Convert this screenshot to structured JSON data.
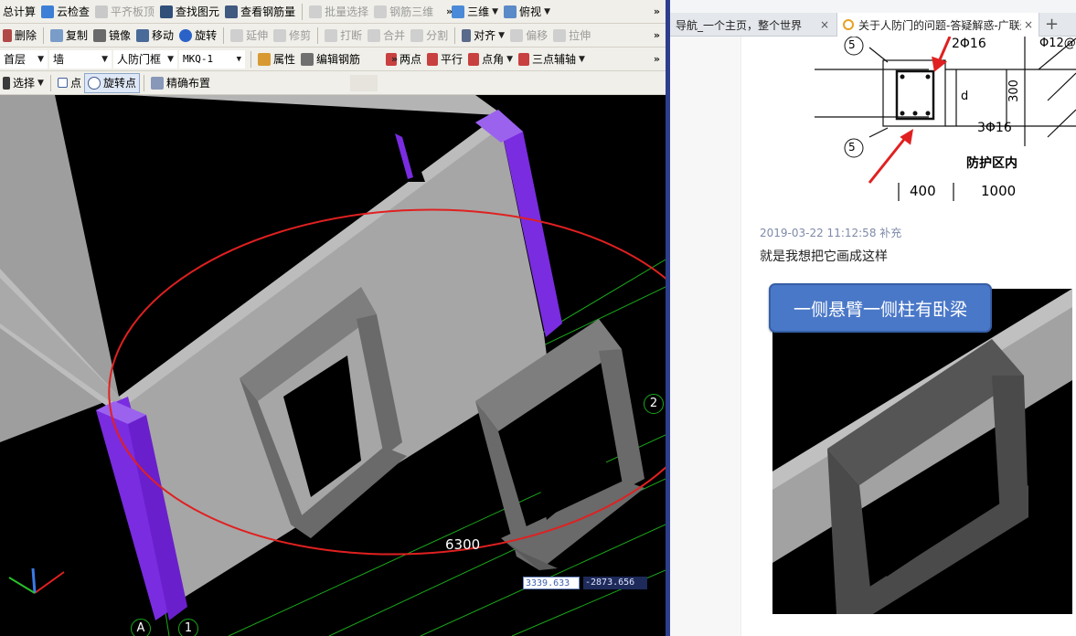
{
  "app": {
    "toolbar1": {
      "calc": "总计算",
      "cloud_check": "云检查",
      "align_slab_top": "平齐板顶",
      "find_element": "查找图元",
      "view_rebar": "查看钢筋量",
      "batch_select": "批量选择",
      "rebar_3d": "钢筋三维",
      "view_3d": "三维",
      "top_view": "俯视"
    },
    "toolbar2": {
      "delete": "删除",
      "copy": "复制",
      "mirror": "镜像",
      "move": "移动",
      "rotate": "旋转",
      "extend": "延伸",
      "trim": "修剪",
      "break": "打断",
      "merge": "合并",
      "split": "分割",
      "align": "对齐",
      "offset": "偏移",
      "stretch": "拉伸"
    },
    "toolbar3": {
      "floor_combo": "首层",
      "type_combo": "墙",
      "element_combo": "人防门框",
      "name_combo": "MKQ-1",
      "properties": "属性",
      "edit_rebar": "编辑钢筋",
      "two_points": "两点",
      "parallel": "平行",
      "point_angle": "点角",
      "three_point_aux": "三点辅轴"
    },
    "toolbar4": {
      "select": "选择",
      "point": "点",
      "rotate_point": "旋转点",
      "precise_layout": "精确布置"
    },
    "viewport": {
      "dimension_label": "6300",
      "axis_a": "A",
      "axis_1": "1",
      "axis_2": "2",
      "coord_x": "3339.633",
      "coord_y": "-2873.656",
      "colors": {
        "wall": "#a6a6a6",
        "column": "#7a2ce0",
        "frame": "#6e6e6e",
        "annotation": "#e02020",
        "grid": "#1aa81a"
      }
    }
  },
  "browser": {
    "tab1_title": "导航_一个主页，整个世界",
    "tab2_title": "关于人防门的问题-答疑解惑-广联达",
    "tab_close": "×",
    "new_tab": "+",
    "drawing": {
      "bar_top": "2Φ16",
      "bar_top_right": "Φ12@",
      "bar_bottom": "3Φ16",
      "depth_label": "d",
      "height_value": "300",
      "zone_label": "防护区内",
      "width_left": "400",
      "width_right": "1000",
      "marker": "5"
    },
    "post_meta": "2019-03-22 11:12:58 补充",
    "post_text": "就是我想把它画成这样",
    "badge_text": "一侧悬臂一侧柱有卧梁"
  }
}
